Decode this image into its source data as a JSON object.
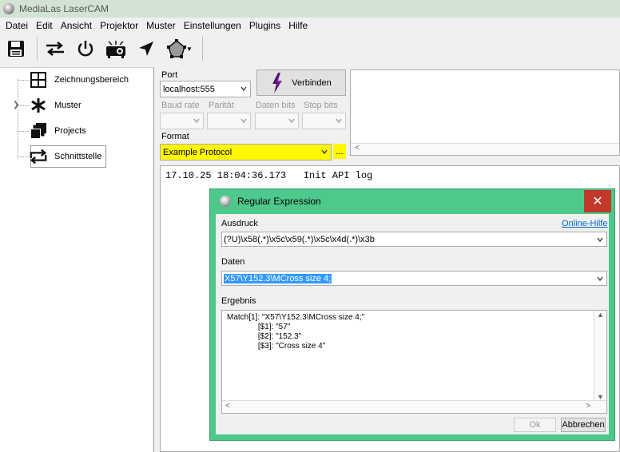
{
  "window": {
    "title": "MediaLas LaserCAM"
  },
  "menu": [
    "Datei",
    "Edit",
    "Ansicht",
    "Projektor",
    "Muster",
    "Einstellungen",
    "Plugins",
    "Hilfe"
  ],
  "toolbar": {
    "icons": [
      "save-icon",
      "swap-arrows-icon",
      "power-icon",
      "projector-icon",
      "cursor-icon",
      "polygon-icon"
    ]
  },
  "tree": {
    "items": [
      {
        "label": "Zeichnungsbereich",
        "icon": "grid-icon"
      },
      {
        "label": "Muster",
        "icon": "asterisk-icon"
      },
      {
        "label": "Projects",
        "icon": "stack-icon"
      },
      {
        "label": "Schnittstelle",
        "icon": "loop-arrows-icon"
      }
    ]
  },
  "connection": {
    "port_label": "Port",
    "port_value": "localhost:555",
    "connect_label": "Verbinden",
    "baud_label": "Baud rate",
    "parity_label": "Parität",
    "databits_label": "Daten bits",
    "stopbits_label": "Stop bits",
    "format_label": "Format",
    "format_value": "Example Protocol",
    "more_label": "..."
  },
  "log": {
    "line": "17.10.25 18:04:36.173   Init API log"
  },
  "dialog": {
    "title": "Regular Expression",
    "close": "✕",
    "expr_label": "Ausdruck",
    "help_link": "Online-Hilfe",
    "expr_value": "(?U)\\x58(.*)\\x5c\\x59(.*)\\x5c\\x4d(.*)\\x3b",
    "data_label": "Daten",
    "data_value": "X57\\Y152.3\\MCross size 4;",
    "result_label": "Ergebnis",
    "result_lines": [
      "Match[1]: \"X57\\Y152.3\\MCross size 4;\"",
      "              [$1]: \"57\"",
      "              [$2]: \"152.3\"",
      "              [$3]: \"Cross size 4\""
    ],
    "ok_label": "Ok",
    "cancel_label": "Abbrechen"
  },
  "colors": {
    "highlight": "#fff800",
    "dialog_frame": "#4dc98c",
    "close": "#c0392b"
  }
}
